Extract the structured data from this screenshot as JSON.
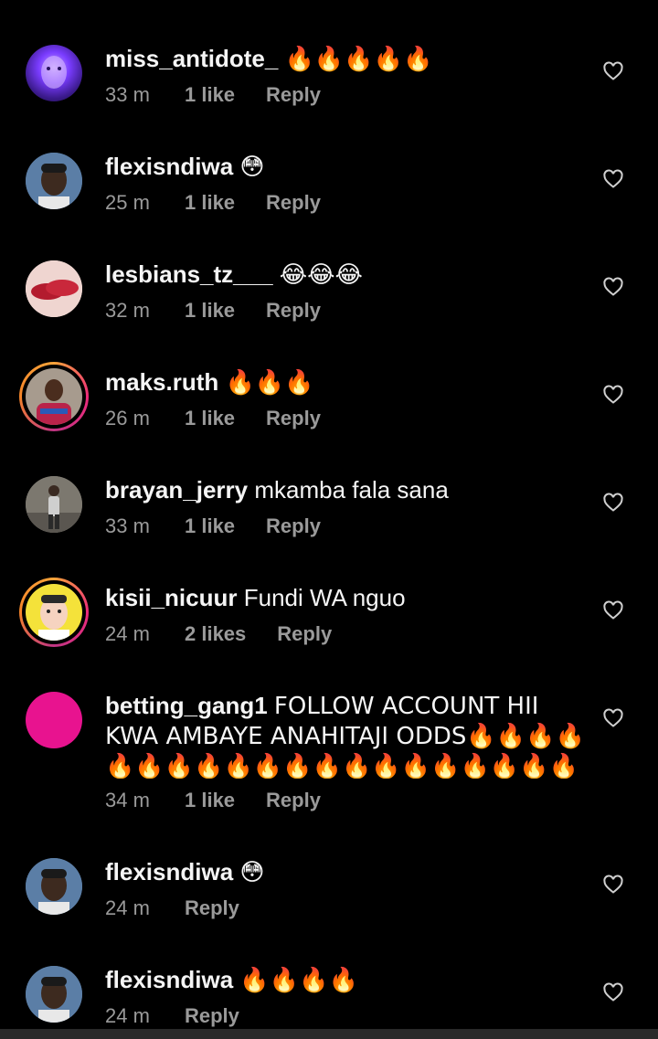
{
  "comments": [
    {
      "username": "miss_antidote_",
      "text": "🔥🔥🔥🔥🔥",
      "time": "33 m",
      "likes": "1 like",
      "reply": "Reply",
      "avatar": "purple-selfie"
    },
    {
      "username": "flexisndiwa",
      "text": "😳",
      "time": "25 m",
      "likes": "1 like",
      "reply": "Reply",
      "avatar": "cartoon-man"
    },
    {
      "username": "lesbians_tz___",
      "text": "😂😂😂",
      "time": "32 m",
      "likes": "1 like",
      "reply": "Reply",
      "avatar": "lips"
    },
    {
      "username": "maks.ruth",
      "text": "🔥🔥🔥",
      "time": "26 m",
      "likes": "1 like",
      "reply": "Reply",
      "avatar": "woman-story-ring"
    },
    {
      "username": "brayan_jerry",
      "text": "mkamba fala sana",
      "time": "33 m",
      "likes": "1 like",
      "reply": "Reply",
      "avatar": "man-standing"
    },
    {
      "username": "kisii_nicuur",
      "text": "Fundi WA nguo",
      "time": "24 m",
      "likes": "2 likes",
      "reply": "Reply",
      "avatar": "cartoon-face-story-ring"
    },
    {
      "username": "betting_gang1",
      "text": "FOLLOW ACCOUNT HII KWA AMBAYE ANAHITAJI ODDS🔥🔥🔥🔥🔥🔥🔥🔥🔥🔥🔥🔥🔥🔥🔥🔥🔥🔥🔥🔥🔥🔥🔥🔥🔥🔥🔥🔥🔥🔥🔥🔥🔥🔥🔥🔥🔥🔥🔥🔥🔥🔥🔥🔥🔥🔥🔥🔥🔥🔥🔥🔥🔥🔥🔥🔥🔥🔥🔥🔥🔥🔥🔥🔥",
      "time": "34 m",
      "likes": "1 like",
      "reply": "Reply",
      "avatar": "magenta-circle"
    },
    {
      "username": "flexisndiwa",
      "text": "😳",
      "time": "24 m",
      "likes": "",
      "reply": "Reply",
      "avatar": "cartoon-man"
    },
    {
      "username": "flexisndiwa",
      "text": "🔥🔥🔥🔥",
      "time": "24 m",
      "likes": "",
      "reply": "Reply",
      "avatar": "cartoon-man"
    }
  ],
  "colors": {
    "background": "#000000",
    "text": "#f5f5f5",
    "meta": "#9a9a9a",
    "magenta": "#e8138f"
  },
  "icons": {
    "like": "heart-outline-icon"
  }
}
